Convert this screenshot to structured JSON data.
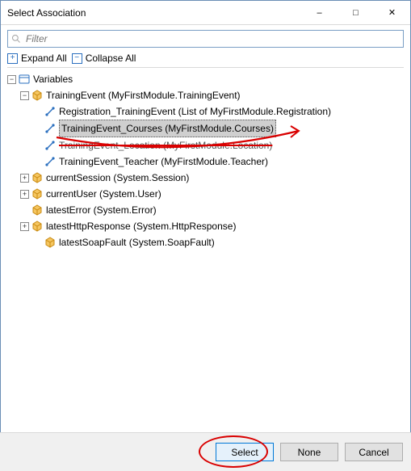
{
  "window": {
    "title": "Select Association"
  },
  "filter": {
    "placeholder": "Filter"
  },
  "toolbar": {
    "expand_all": "Expand All",
    "collapse_all": "Collapse All"
  },
  "tree": {
    "root": {
      "label": "Variables",
      "children": {
        "training_event": {
          "label": "TrainingEvent (MyFirstModule.TrainingEvent)",
          "children": {
            "registration": "Registration_TrainingEvent (List of MyFirstModule.Registration)",
            "courses": "TrainingEvent_Courses (MyFirstModule.Courses)",
            "location": "TrainingEvent_Location (MyFirstModule.Location)",
            "teacher": "TrainingEvent_Teacher (MyFirstModule.Teacher)"
          }
        },
        "current_session": "currentSession (System.Session)",
        "current_user": "currentUser (System.User)",
        "latest_error": "latestError (System.Error)",
        "latest_http_response": {
          "label": "latestHttpResponse (System.HttpResponse)",
          "children": {
            "latest_soap_fault": "latestSoapFault (System.SoapFault)"
          }
        }
      }
    }
  },
  "buttons": {
    "select": "Select",
    "none": "None",
    "cancel": "Cancel"
  }
}
